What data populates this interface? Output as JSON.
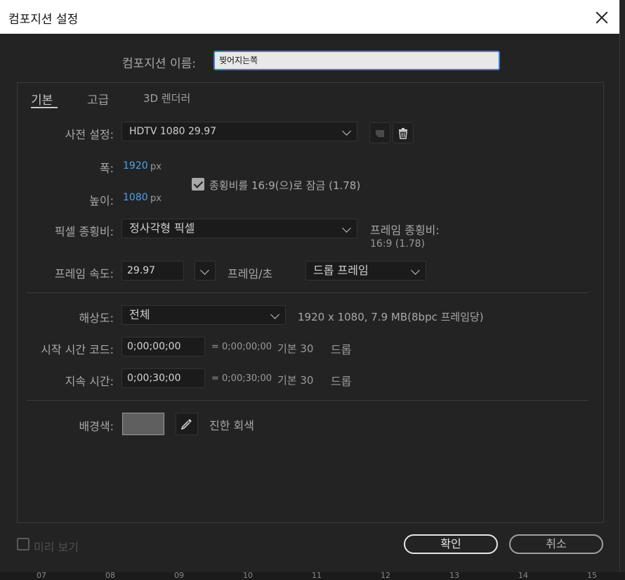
{
  "window": {
    "title": "컴포지션 설정"
  },
  "composition_name": {
    "label": "컴포지션 이름:",
    "value": "찢어지는쪽"
  },
  "tabs": [
    {
      "label": "기본",
      "active": true
    },
    {
      "label": "고급",
      "active": false
    },
    {
      "label": "3D 렌더러",
      "active": false
    }
  ],
  "basic": {
    "preset": {
      "label": "사전 설정:",
      "value": "HDTV 1080 29.97"
    },
    "width": {
      "label": "폭:",
      "value": "1920",
      "unit": "px"
    },
    "height": {
      "label": "높이:",
      "value": "1080",
      "unit": "px"
    },
    "lock_aspect": {
      "checked": true,
      "label": "종횡비를 16:9(으)로 잠금 (1.78)"
    },
    "pixel_aspect": {
      "label": "픽셀 종횡비:",
      "value": "정사각형 픽셀"
    },
    "frame_aspect": {
      "label": "프레임 종횡비:",
      "value": "16:9 (1.78)"
    },
    "frame_rate": {
      "label": "프레임 속도:",
      "value": "29.97",
      "unit": "프레임/초",
      "drop": "드롭 프레임"
    },
    "resolution": {
      "label": "해상도:",
      "value": "전체",
      "info": "1920 x 1080, 7.9 MB(8bpc 프레임당)"
    },
    "start_timecode": {
      "label": "시작 시간 코드:",
      "value": "0;00;00;00",
      "equals": "= 0;00;00;00",
      "base": "기본 30",
      "drop": "드롭"
    },
    "duration": {
      "label": "지속 시간:",
      "value": "0;00;30;00",
      "equals": "= 0;00;30;00",
      "base": "기본 30",
      "drop": "드롭"
    },
    "background": {
      "label": "배경색:",
      "color": "#5f5f5f",
      "name": "진한 회색"
    }
  },
  "footer": {
    "preview_label": "미리 보기",
    "ok_label": "확인",
    "cancel_label": "취소"
  },
  "ruler": [
    "07",
    "08",
    "09",
    "10",
    "11",
    "12",
    "13",
    "14",
    "15"
  ],
  "colors": {
    "accent": "#3d7fd6",
    "value_blue": "#4aa3f0",
    "panel": "#232323"
  }
}
